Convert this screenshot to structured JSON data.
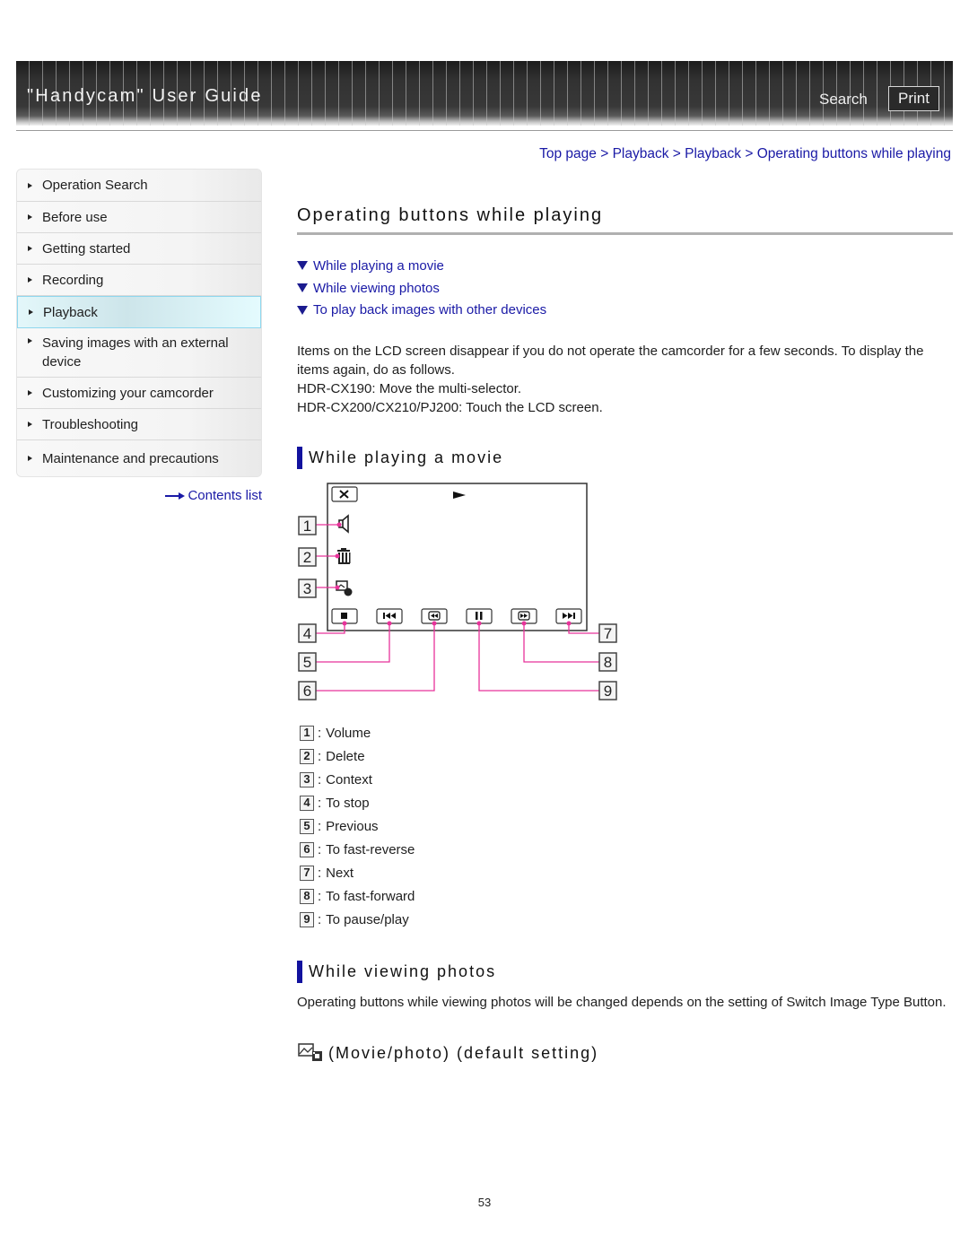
{
  "header": {
    "title": "\"Handycam\" User Guide",
    "search_label": "Search",
    "print_label": "Print"
  },
  "breadcrumb": [
    {
      "label": "Top page"
    },
    {
      "label": "Playback"
    },
    {
      "label": "Playback"
    },
    {
      "label": "Operating buttons while playing"
    }
  ],
  "breadcrumb_separator": ">",
  "sidebar": {
    "items": [
      {
        "label": "Operation Search",
        "active": false
      },
      {
        "label": "Before use",
        "active": false
      },
      {
        "label": "Getting started",
        "active": false
      },
      {
        "label": "Recording",
        "active": false
      },
      {
        "label": "Playback",
        "active": true
      },
      {
        "label": "Saving images with an external device",
        "active": false
      },
      {
        "label": "Customizing your camcorder",
        "active": false
      },
      {
        "label": "Troubleshooting",
        "active": false
      },
      {
        "label": "Maintenance and precautions",
        "active": false
      }
    ],
    "contents_link": "Contents list"
  },
  "main": {
    "title": "Operating buttons while playing",
    "toc": [
      {
        "label": "While playing a movie"
      },
      {
        "label": "While viewing photos"
      },
      {
        "label": "To play back images with other devices"
      }
    ],
    "intro": [
      "Items on the LCD screen disappear if you do not operate the camcorder for a few seconds. To display the items again, do as follows.",
      "HDR-CX190: Move the multi-selector.",
      "HDR-CX200/CX210/PJ200: Touch the LCD screen."
    ],
    "section_movie": {
      "heading": "While playing a movie",
      "diagram": {
        "screen_icons": [
          "close-icon",
          "play-indicator-icon",
          "volume-icon",
          "delete-icon",
          "context-icon"
        ],
        "buttons": [
          "stop-icon",
          "previous-icon",
          "fast-reverse-icon",
          "pause-play-icon",
          "fast-forward-icon",
          "next-icon"
        ],
        "callouts": [
          "1",
          "2",
          "3",
          "4",
          "5",
          "6",
          "7",
          "8",
          "9"
        ],
        "leader_color": "#e8339a"
      },
      "legend": [
        {
          "num": "1",
          "label": "Volume"
        },
        {
          "num": "2",
          "label": "Delete"
        },
        {
          "num": "3",
          "label": "Context"
        },
        {
          "num": "4",
          "label": "To stop"
        },
        {
          "num": "5",
          "label": "Previous"
        },
        {
          "num": "6",
          "label": "To fast-reverse"
        },
        {
          "num": "7",
          "label": "Next"
        },
        {
          "num": "8",
          "label": "To fast-forward"
        },
        {
          "num": "9",
          "label": "To pause/play"
        }
      ],
      "legend_separator": ":"
    },
    "section_photos": {
      "heading": "While viewing photos",
      "description": "Operating buttons while viewing photos will be changed depends on the setting of Switch Image Type Button.",
      "subheading": "(Movie/photo) (default setting)"
    }
  },
  "footer": {
    "page_number": "53"
  },
  "colors": {
    "link": "#1a1aa6",
    "section_bar": "#12129e",
    "active_nav_border": "#8fd7ee",
    "leader_line": "#e8339a"
  }
}
